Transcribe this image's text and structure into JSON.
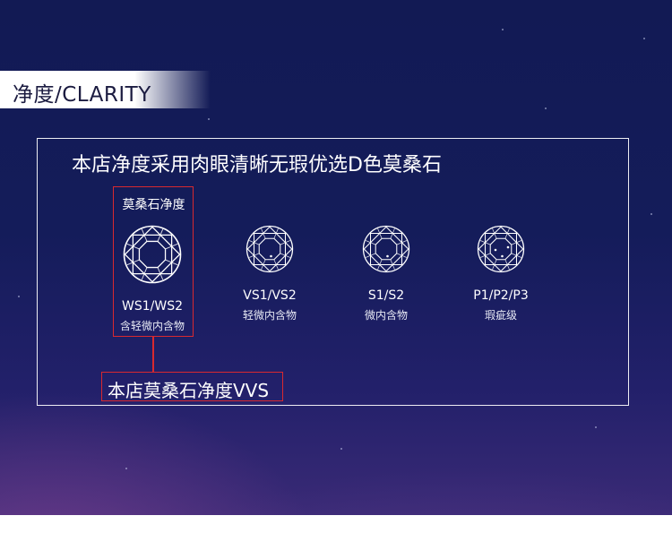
{
  "section_title": "净度/CLARITY",
  "panel_heading": "本店净度采用肉眼清晰无瑕优选D色莫桑石",
  "highlight_caption": "莫桑石净度",
  "grades": [
    {
      "name": "WS1/WS2",
      "desc": "含轻微内含物",
      "icon": "diamond-icon",
      "inclusions": 0
    },
    {
      "name": "VS1/VS2",
      "desc": "轻微内含物",
      "icon": "diamond-icon",
      "inclusions": 1
    },
    {
      "name": "S1/S2",
      "desc": "微内含物",
      "icon": "diamond-icon",
      "inclusions": 1
    },
    {
      "name": "P1/P2/P3",
      "desc": "瑕疵级",
      "icon": "diamond-icon",
      "inclusions": 3
    }
  ],
  "callout_text": "本店莫桑石净度VVS",
  "colors": {
    "highlight": "#d8292f",
    "background": "#141c5a"
  }
}
